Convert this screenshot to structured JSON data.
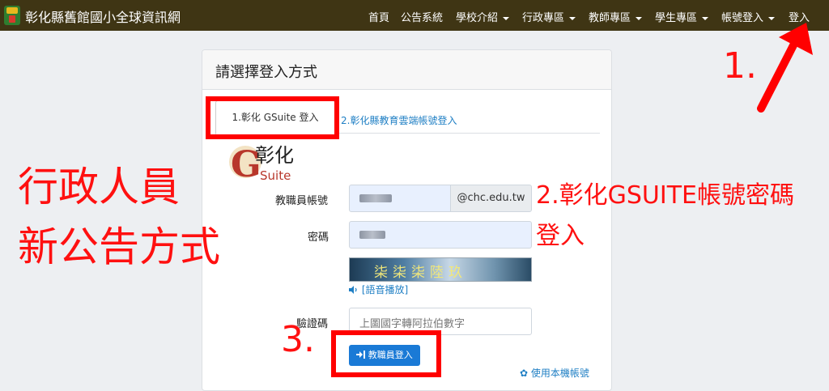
{
  "navbar": {
    "brand": "彰化縣舊館國小全球資訊網",
    "items": [
      {
        "label": "首頁",
        "dropdown": false
      },
      {
        "label": "公告系統",
        "dropdown": false
      },
      {
        "label": "學校介紹",
        "dropdown": true
      },
      {
        "label": "行政專區",
        "dropdown": true
      },
      {
        "label": "教師專區",
        "dropdown": true
      },
      {
        "label": "學生專區",
        "dropdown": true
      },
      {
        "label": "帳號登入",
        "dropdown": true
      },
      {
        "label": "登入",
        "dropdown": false
      }
    ]
  },
  "card": {
    "title": "請選擇登入方式",
    "tabs": [
      "1.彰化 GSuite 登入",
      "2.彰化縣教育雲端帳號登入"
    ],
    "logo_text": "彰化",
    "logo_letter": "G",
    "logo_sub": "Suite",
    "account_label": "教職員帳號",
    "account_suffix": "@chc.edu.tw",
    "password_label": "密碼",
    "captcha_text": "柒柒柒陸玖",
    "audio_label": "[語音播放]",
    "verify_label": "驗證碼",
    "verify_placeholder": "上圖國字轉阿拉伯數字",
    "login_button": "教職員登入",
    "local_account_link": "使用本機帳號"
  },
  "annotations": {
    "step1": "1.",
    "step2_line1": "2.彰化GSUITE帳號密碼",
    "step2_line2": "登入",
    "step3": "3.",
    "left_line1": "行政人員",
    "left_line2": "新公告方式"
  },
  "colors": {
    "navbar_bg": "#3f3514",
    "page_bg": "#edeff2",
    "link_blue": "#1f7fc4",
    "button_blue": "#1a7ad6",
    "annotation_red": "#ff0000"
  }
}
